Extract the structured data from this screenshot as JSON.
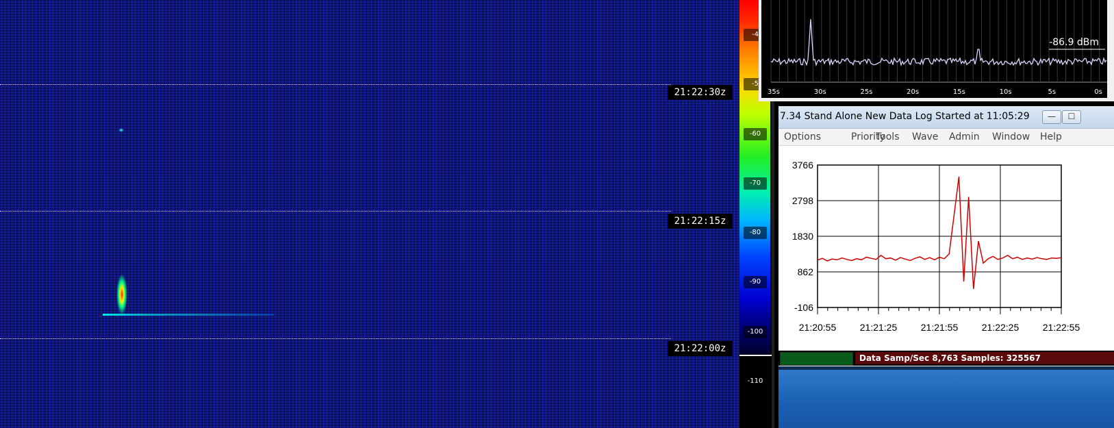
{
  "waterfall": {
    "time_labels": [
      "21:22:30z",
      "21:22:15z",
      "21:22:00z"
    ]
  },
  "color_scale": {
    "labels": [
      "-4",
      "-5",
      "-60",
      "-70",
      "-80",
      "-90",
      "-100",
      "-110"
    ]
  },
  "spectrum": {
    "power_readout": "-86.9 dBm",
    "time_ticks": [
      "35s",
      "30s",
      "25s",
      "20s",
      "15s",
      "10s",
      "5s",
      "0s"
    ]
  },
  "app_window": {
    "title": "7.34  Stand Alone   New Data Log Started at 11:05:29",
    "buttons": {
      "minimize": "—",
      "maximize": "☐"
    },
    "menu": [
      "Options",
      "Priority",
      "Tools",
      "Wave",
      "Admin",
      "Window",
      "Help"
    ],
    "status_text": "Data Samp/Sec 8,763   Samples:  325567"
  },
  "chart_data": {
    "type": "line",
    "title": "",
    "xlabel": "",
    "ylabel": "",
    "y_ticks": [
      "3766",
      "2798",
      "1830",
      "862",
      "-106"
    ],
    "x_ticks": [
      "21:20:55",
      "21:21:25",
      "21:21:55",
      "21:22:25",
      "21:22:55"
    ],
    "ylim": [
      -106,
      3766
    ],
    "grid": true,
    "series_color": "#cc0000",
    "series": [
      {
        "values": [
          1180,
          1230,
          1160,
          1210,
          1190,
          1240,
          1200,
          1170,
          1220,
          1190,
          1260,
          1230,
          1200,
          1310,
          1220,
          1240,
          1180,
          1250,
          1210,
          1170,
          1230,
          1270,
          1200,
          1250,
          1190,
          1260,
          1220,
          1350,
          2400,
          3450,
          600,
          2900,
          400,
          1700,
          1100,
          1220,
          1280,
          1200,
          1240,
          1310,
          1220,
          1260,
          1200,
          1240,
          1210,
          1250,
          1220,
          1200,
          1240,
          1230,
          1250
        ]
      }
    ]
  }
}
